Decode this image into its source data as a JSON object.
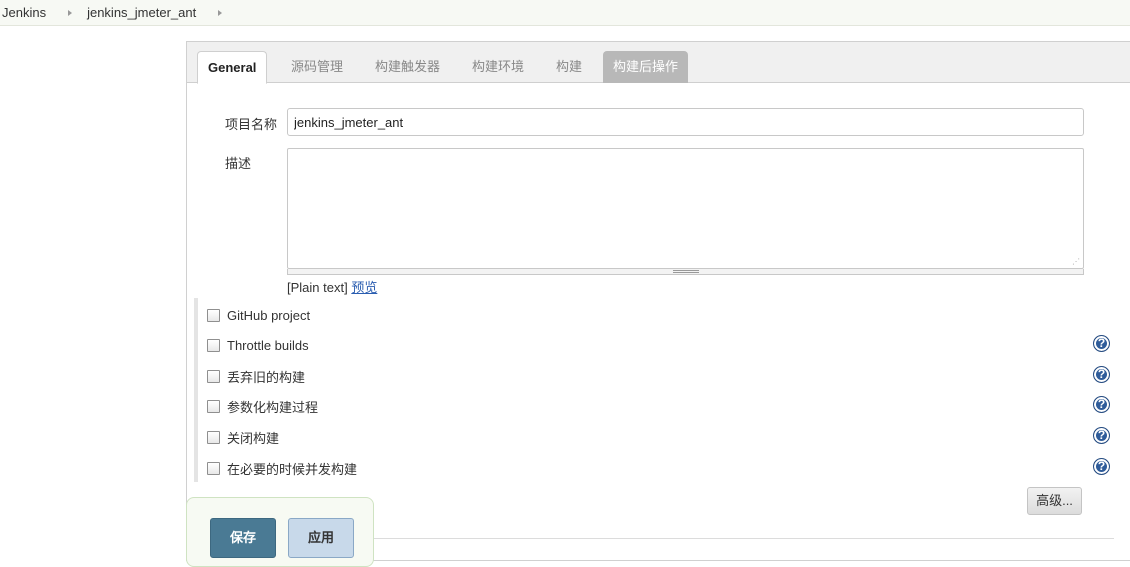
{
  "breadcrumb": {
    "items": [
      "Jenkins",
      "jenkins_jmeter_ant"
    ]
  },
  "tabs": [
    {
      "label": "General",
      "state": "active"
    },
    {
      "label": "源码管理",
      "state": "normal"
    },
    {
      "label": "构建触发器",
      "state": "normal"
    },
    {
      "label": "构建环境",
      "state": "normal"
    },
    {
      "label": "构建",
      "state": "normal"
    },
    {
      "label": "构建后操作",
      "state": "highlighted"
    }
  ],
  "form": {
    "project_name_label": "项目名称",
    "project_name_value": "jenkins_jmeter_ant",
    "description_label": "描述",
    "description_value": "",
    "plain_text": "[Plain text]",
    "preview_link": "预览"
  },
  "options": [
    {
      "label": "GitHub project",
      "checked": false,
      "has_help": false
    },
    {
      "label": "Throttle builds",
      "checked": false,
      "has_help": true
    },
    {
      "label": "丢弃旧的构建",
      "checked": false,
      "has_help": true
    },
    {
      "label": "参数化构建过程",
      "checked": false,
      "has_help": true
    },
    {
      "label": "关闭构建",
      "checked": false,
      "has_help": true
    },
    {
      "label": "在必要的时候并发构建",
      "checked": false,
      "has_help": true
    }
  ],
  "help_glyph": "?",
  "advanced_button": "高级...",
  "buttons": {
    "save": "保存",
    "apply": "应用"
  },
  "colors": {
    "save_button": "#4a7a94",
    "apply_button": "#c8d9ea",
    "help_icon": "#2f5c9a",
    "link": "#2a5db0"
  }
}
